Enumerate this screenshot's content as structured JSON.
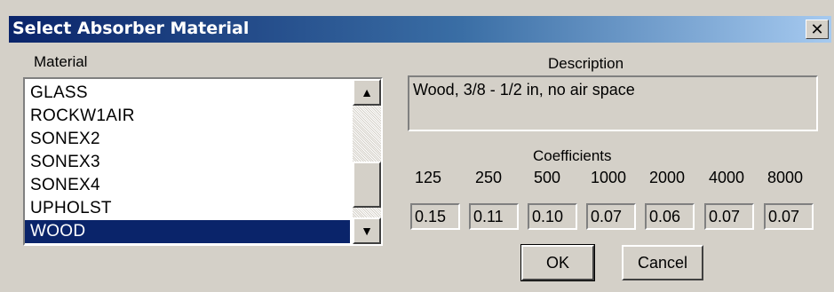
{
  "window": {
    "title": "Select Absorber Material",
    "close_glyph": "✕"
  },
  "material": {
    "label": "Material",
    "items": [
      "GLASS",
      "ROCKW1AIR",
      "SONEX2",
      "SONEX3",
      "SONEX4",
      "UPHOLST",
      "WOOD"
    ],
    "selected": "WOOD"
  },
  "scrollbar": {
    "up_glyph": "▲",
    "down_glyph": "▼"
  },
  "description": {
    "label": "Description",
    "text": "Wood, 3/8 - 1/2 in, no air space"
  },
  "coefficients": {
    "label": "Coefficients",
    "frequencies": [
      "125",
      "250",
      "500",
      "1000",
      "2000",
      "4000",
      "8000"
    ],
    "values": [
      "0.15",
      "0.11",
      "0.10",
      "0.07",
      "0.06",
      "0.07",
      "0.07"
    ]
  },
  "buttons": {
    "ok": "OK",
    "cancel": "Cancel"
  },
  "colors": {
    "title_bar_start": "#0a246a",
    "title_bar_end": "#a6caf0",
    "face": "#d4d0c8",
    "selection": "#0a246a"
  }
}
